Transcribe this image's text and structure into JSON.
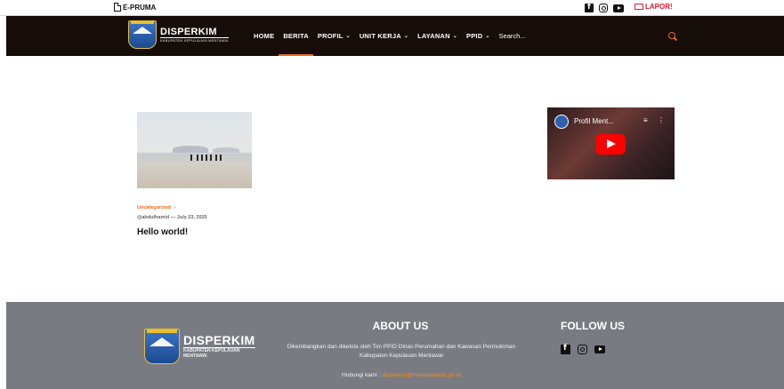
{
  "topbar": {
    "eprum_label": "E-PRUMA",
    "lapor_label": "LAPOR!",
    "social_icons": [
      "facebook-icon",
      "instagram-icon",
      "youtube-icon"
    ]
  },
  "header": {
    "logo_title": "DISPERKIM",
    "logo_subtitle": "KABUPATEN KEPULAUAN MENTAWAI",
    "nav": [
      {
        "label": "HOME",
        "dropdown": false
      },
      {
        "label": "BERITA",
        "dropdown": false,
        "active": true
      },
      {
        "label": "PROFIL",
        "dropdown": true
      },
      {
        "label": "UNIT KERJA",
        "dropdown": true
      },
      {
        "label": "LAYANAN",
        "dropdown": true
      },
      {
        "label": "PPID",
        "dropdown": true
      }
    ],
    "search_placeholder": "Search...",
    "accent": "#e86a17",
    "background": "#160d09"
  },
  "post": {
    "category": "Uncategorized",
    "author": "@abdulhamid",
    "date": "July 23, 2025",
    "title": "Hello world!"
  },
  "video": {
    "title": "Profil Ment..."
  },
  "footer": {
    "logo_title": "DISPERKIM",
    "logo_subtitle_1": "KABUPATEN KEPULAUAN",
    "logo_subtitle_2": "MENTAWAI",
    "about_heading": "ABOUT US",
    "about_text": "Dikembangkan dan dikelola oleh Tim PPID Dinas Perumahan dan Kawasan Permukiman Kabupaten Kepulauan Mentawai",
    "contact_label": "Hubungi kami :",
    "contact_email": "disperkim@mentawaikab.go.id",
    "follow_heading": "FOLLOW US",
    "background": "#787b82",
    "link_color": "#f08a24"
  }
}
